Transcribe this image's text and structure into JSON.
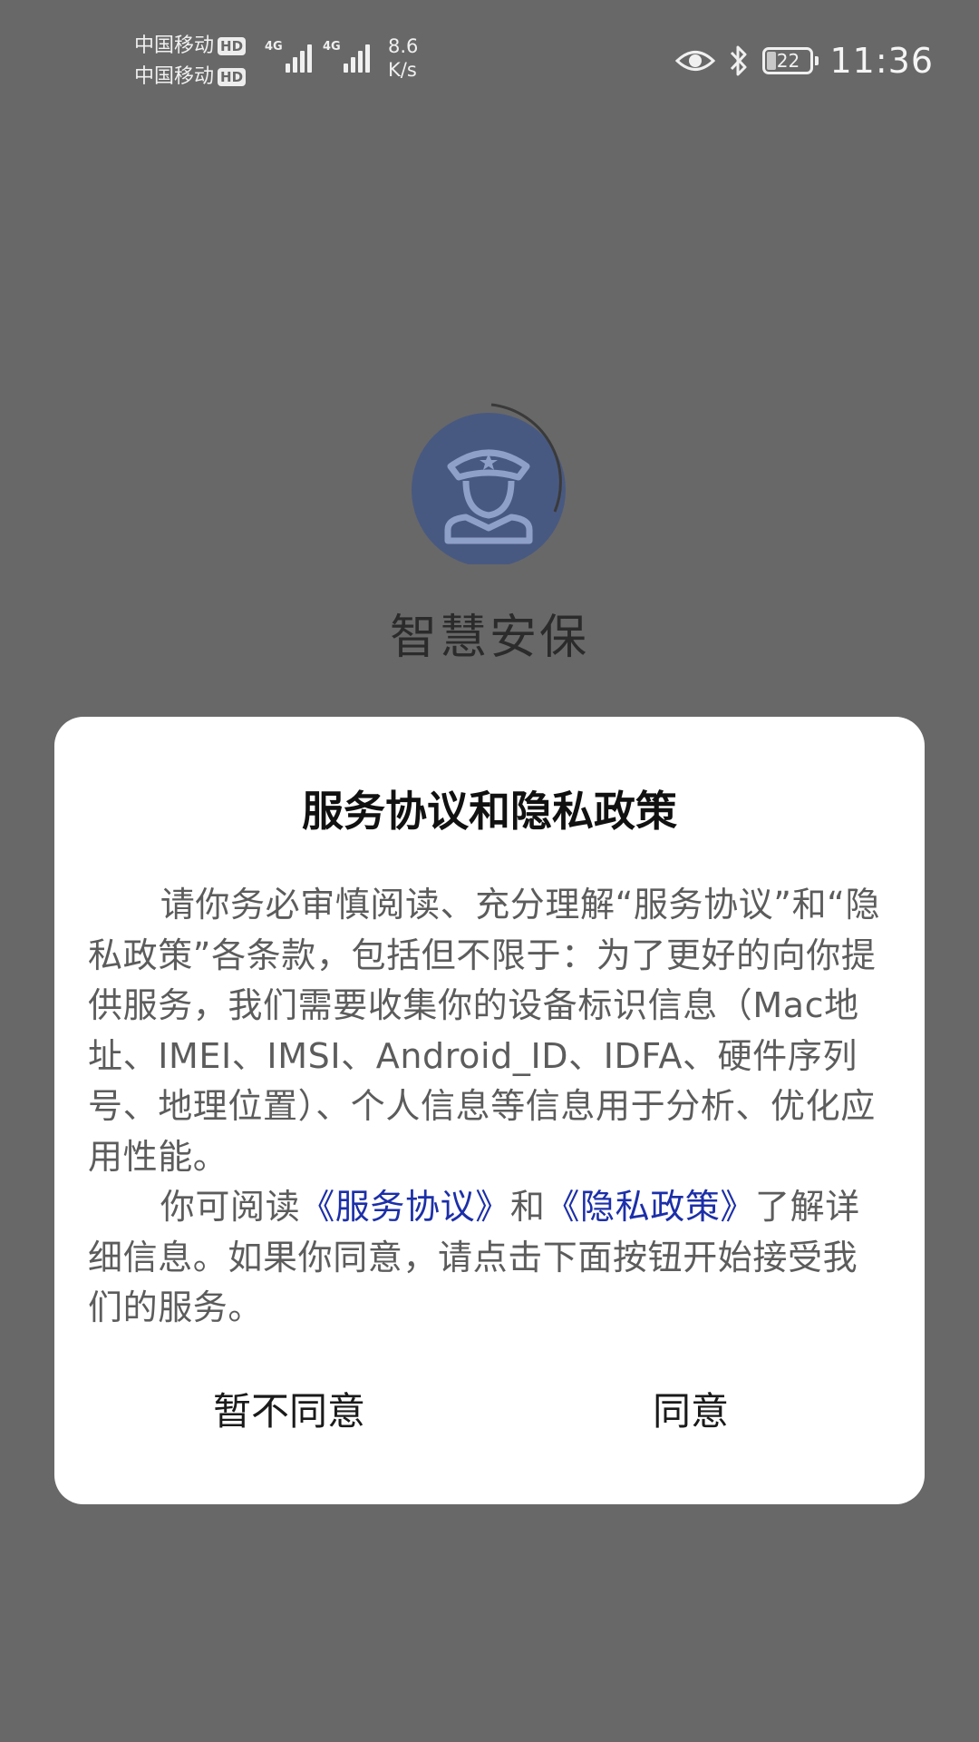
{
  "status_bar": {
    "carrier_1": "中国移动",
    "carrier_2": "中国移动",
    "hd_badge": "HD",
    "net_type": "4G",
    "speed_value": "8.6",
    "speed_unit": "K/s",
    "battery_level": "22",
    "time": "11:36",
    "icons": [
      "eye-icon",
      "bluetooth-icon",
      "battery-icon",
      "signal-icon"
    ]
  },
  "app": {
    "name": "智慧安保",
    "logo_color": "#2d4c95"
  },
  "dialog": {
    "title": "服务协议和隐私政策",
    "para1": "请你务必审慎阅读、充分理解“服务协议”和“隐私政策”各条款，包括但不限于：为了更好的向你提供服务，我们需要收集你的设备标识信息（Mac地址、IMEI、IMSI、Android_ID、IDFA、硬件序列号、地理位置）、个人信息等信息用于分析、优化应用性能。",
    "para2_prefix": "你可阅读",
    "link_service": "《服务协议》",
    "para2_and": "和",
    "link_privacy": "《隐私政策》",
    "para2_suffix": "了解详细信息。如果你同意，请点击下面按钮开始接受我们的服务。",
    "disagree_label": "暂不同意",
    "agree_label": "同意",
    "link_color": "#1c2fa8"
  }
}
